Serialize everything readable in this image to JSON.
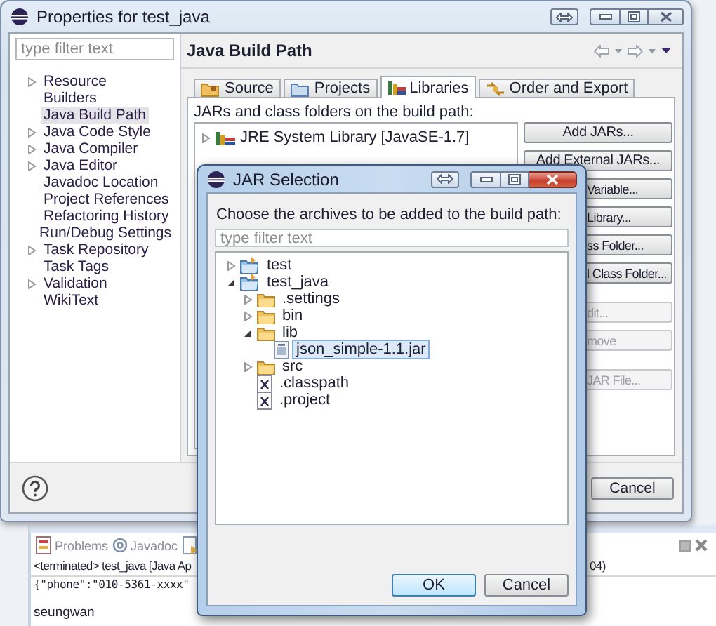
{
  "properties_window": {
    "title": "Properties for test_java",
    "filter": {
      "placeholder": "type filter text"
    },
    "categories": [
      {
        "label": "Resource",
        "expanded": false,
        "selected": false
      },
      {
        "label": "Builders",
        "selected": false
      },
      {
        "label": "Java Build Path",
        "selected": true
      },
      {
        "label": "Java Code Style",
        "expanded": false,
        "selected": false
      },
      {
        "label": "Java Compiler",
        "expanded": false,
        "selected": false
      },
      {
        "label": "Java Editor",
        "expanded": false,
        "selected": false
      },
      {
        "label": "Javadoc Location",
        "selected": false
      },
      {
        "label": "Project References",
        "selected": false
      },
      {
        "label": "Refactoring History",
        "selected": false
      },
      {
        "label": "Run/Debug Settings",
        "selected": false
      },
      {
        "label": "Task Repository",
        "expanded": false,
        "selected": false
      },
      {
        "label": "Task Tags",
        "selected": false
      },
      {
        "label": "Validation",
        "expanded": false,
        "selected": false
      },
      {
        "label": "WikiText",
        "selected": false
      }
    ],
    "page_title": "Java Build Path",
    "tabs": [
      {
        "label": "Source",
        "kind": "source",
        "selected": false
      },
      {
        "label": "Projects",
        "kind": "projects",
        "selected": false
      },
      {
        "label": "Libraries",
        "kind": "libraries",
        "selected": true
      },
      {
        "label": "Order and Export",
        "kind": "order",
        "selected": false
      }
    ],
    "list_caption": "JARs and class folders on the build path:",
    "build_path": [
      {
        "label": "JRE System Library [JavaSE-1.7]",
        "expanded": false
      }
    ],
    "buttons": [
      {
        "label": "Add JARs...",
        "disabled": false
      },
      {
        "label": "Add External JARs...",
        "disabled": false
      },
      {
        "label": "Variable...",
        "disabled": false
      },
      {
        "label": "Library...",
        "disabled": false
      },
      {
        "label": "ss Folder...",
        "disabled": false
      },
      {
        "label": "l Class Folder...",
        "disabled": false
      },
      {
        "label": "dit...",
        "disabled": true
      },
      {
        "label": "move",
        "disabled": true
      },
      {
        "label": "JAR File...",
        "disabled": true
      }
    ],
    "footer_buttons": [
      "Cancel"
    ]
  },
  "jar_selection_dialog": {
    "title": "JAR Selection",
    "message": "Choose the archives to be added to the build path:",
    "filter": {
      "placeholder": "type filter text"
    },
    "tree": [
      {
        "label": "test",
        "kind": "project",
        "expanded": false,
        "selected": false
      },
      {
        "label": "test_java",
        "kind": "project",
        "expanded": true,
        "selected": false,
        "children": [
          {
            "label": ".settings",
            "kind": "folder",
            "expanded": false,
            "selected": false
          },
          {
            "label": "bin",
            "kind": "folder",
            "expanded": false,
            "selected": false
          },
          {
            "label": "lib",
            "kind": "folder",
            "expanded": true,
            "selected": false,
            "children": [
              {
                "label": "json_simple-1.1.jar",
                "kind": "jar",
                "selected": true
              }
            ]
          },
          {
            "label": "src",
            "kind": "folder",
            "expanded": false,
            "selected": false
          },
          {
            "label": ".classpath",
            "kind": "file",
            "selected": false
          },
          {
            "label": ".project",
            "kind": "file",
            "selected": false
          }
        ]
      }
    ],
    "buttons": [
      {
        "label": "OK",
        "default": true
      },
      {
        "label": "Cancel",
        "default": false
      }
    ]
  },
  "console": {
    "tabs": [
      {
        "label": "Problems",
        "kind": "problems"
      },
      {
        "label": "Javadoc",
        "kind": "javadoc"
      },
      {
        "kind": "declaration"
      }
    ],
    "status": {
      "left": "<terminated> test_java [Java Ap",
      "right": "04)"
    },
    "lines": [
      "{\"phone\":\"010-5361-xxxx\"",
      "seungwan"
    ]
  }
}
